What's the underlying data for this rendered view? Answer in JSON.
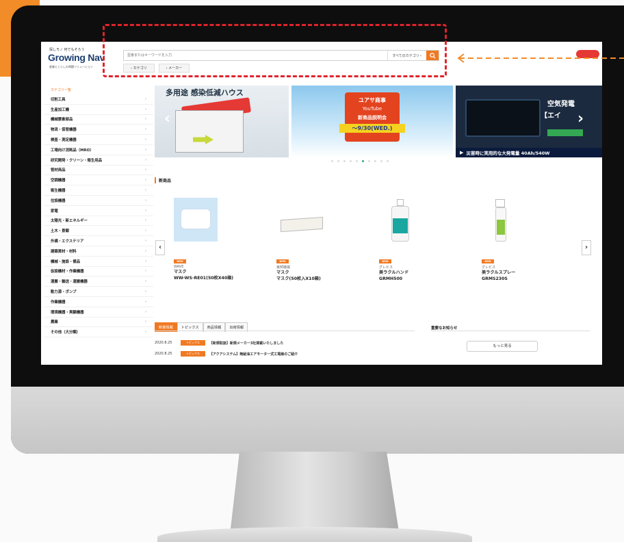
{
  "header": {
    "tagline": "探しモノ 何でもそろう",
    "logo": "Growing Nav",
    "logo_sub": "産業とくらしの問題ソリューション",
    "search_placeholder": "型番またはキーワードを入力",
    "search_category": "すべてのカテゴリ",
    "filter_category": "カテゴリ",
    "filter_maker": "メーカー"
  },
  "sidebar": {
    "heading": "カテゴリ一覧",
    "items": [
      "切削工具",
      "生産加工機",
      "機械要素部品",
      "物流・保管機器",
      "検査・測定機器",
      "工場向け消耗品（MRO）",
      "研究開発・クリーン・衛生用品",
      "管材商品",
      "空調機器",
      "衛生機器",
      "住設機器",
      "家電",
      "太陽光・新エネルギー",
      "土木・景観",
      "外構・エクステリア",
      "建築資材・材料",
      "機械・施設・備品",
      "仮設機材・作業機器",
      "運搬・輸送・運搬機器",
      "動力源・ポンプ",
      "作業機器",
      "環境機器・実験機器",
      "農業",
      "その他（大分類）"
    ]
  },
  "carousel": {
    "banner1_title": "多用途 感染低減ハウス",
    "banner2_line1": "ユアサ商事",
    "banner2_line2": "YouTube",
    "banner2_line3": "新商品説明会",
    "banner2_date": "～9/30(WED.)",
    "banner3_title": "空気発電",
    "banner3_sub": "【エイ",
    "banner3_bar": "災害時に実用的な大発電量 40Ah/540W",
    "dots_count": 10,
    "active_dot": 5
  },
  "products": {
    "section_title": "新商品",
    "items": [
      {
        "tag": "NEW",
        "maker": "WAVE",
        "name": "マスク",
        "model": "WW-WS-RE01(50枚X40箱)"
      },
      {
        "tag": "NEW",
        "maker": "東邦機械",
        "name": "マスク",
        "model": "マスク(50枚入X10箱)"
      },
      {
        "tag": "NEW",
        "maker": "グレビス",
        "name": "美ラクルハンド",
        "model": "GRMH500"
      },
      {
        "tag": "NEW",
        "maker": "グレビス",
        "name": "美ラクルスプレー",
        "model": "GRMS230S"
      }
    ]
  },
  "news": {
    "tabs": [
      "新着情報",
      "トピックス",
      "商品情報",
      "出荷情報"
    ],
    "active_tab": 0,
    "notice_title": "重要なお知らせ",
    "more_label": "もっと見る",
    "rows": [
      {
        "date": "2020.8.25",
        "tag": "トピックス",
        "text": "【新規取扱】新規メーカー3社掲載いたしました"
      },
      {
        "date": "2020.8.25",
        "tag": "トピックス",
        "text": "【アクアシステム】無給油エアモーター式工場扇のご紹介"
      }
    ]
  },
  "colors": {
    "accent": "#f07a23",
    "highlight": "#e0232b",
    "brand_navy": "#1a3d6e"
  }
}
